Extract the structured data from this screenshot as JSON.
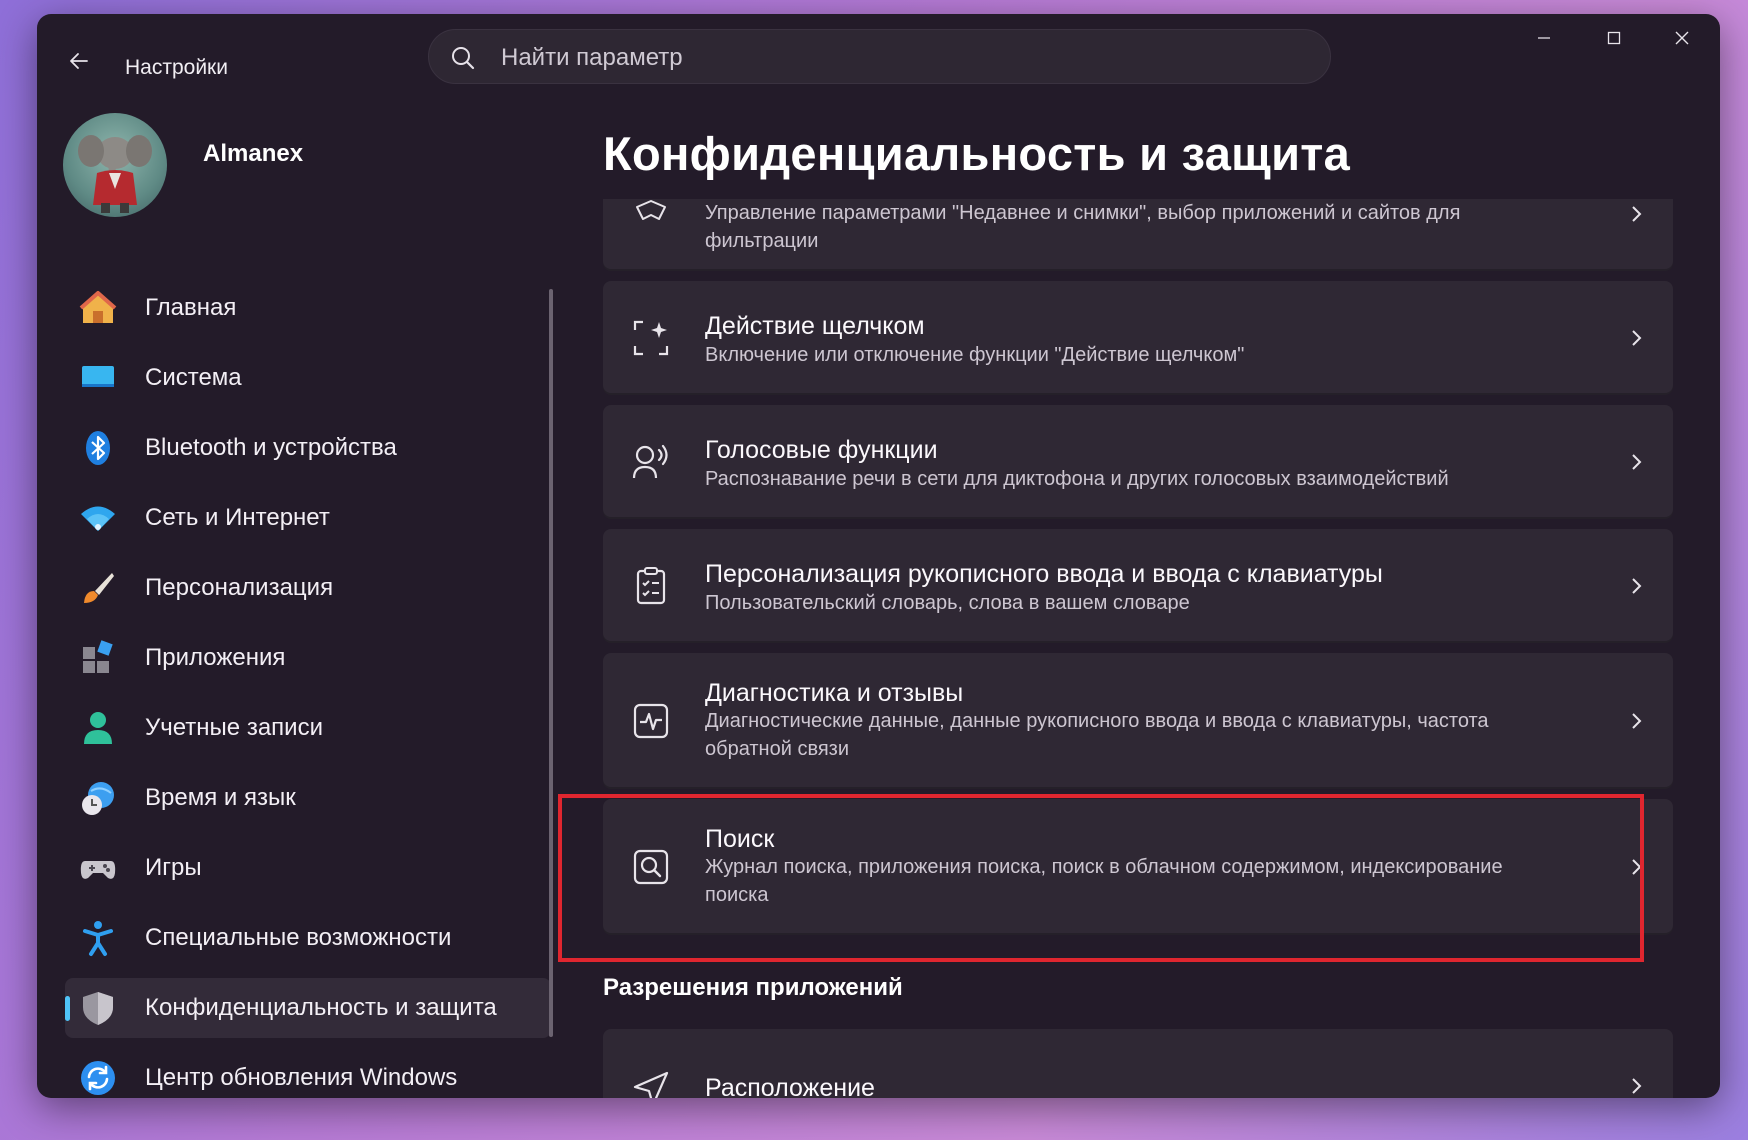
{
  "app": {
    "title": "Настройки"
  },
  "search": {
    "placeholder": "Найти параметр"
  },
  "user": {
    "name": "Almanex"
  },
  "sidebar": {
    "items": [
      {
        "label": "Главная",
        "icon": "home-icon"
      },
      {
        "label": "Система",
        "icon": "system-icon"
      },
      {
        "label": "Bluetooth и устройства",
        "icon": "bluetooth-icon"
      },
      {
        "label": "Сеть и Интернет",
        "icon": "wifi-icon"
      },
      {
        "label": "Персонализация",
        "icon": "brush-icon"
      },
      {
        "label": "Приложения",
        "icon": "apps-icon"
      },
      {
        "label": "Учетные записи",
        "icon": "account-icon"
      },
      {
        "label": "Время и язык",
        "icon": "time-language-icon"
      },
      {
        "label": "Игры",
        "icon": "gamepad-icon"
      },
      {
        "label": "Специальные возможности",
        "icon": "accessibility-icon"
      },
      {
        "label": "Конфиденциальность и защита",
        "icon": "shield-icon",
        "active": true
      },
      {
        "label": "Центр обновления Windows",
        "icon": "update-icon"
      }
    ]
  },
  "main": {
    "title": "Конфиденциальность и защита",
    "cards": [
      {
        "title": "",
        "description": "Управление параметрами \"Недавнее и снимки\", выбор приложений и сайтов для фильтрации",
        "icon": "recall-icon"
      },
      {
        "title": "Действие щелчком",
        "description": "Включение или отключение функции \"Действие щелчком\"",
        "icon": "click-to-do-icon"
      },
      {
        "title": "Голосовые функции",
        "description": "Распознавание речи в сети для диктофона и других голосовых взаимодействий",
        "icon": "speech-icon"
      },
      {
        "title": "Персонализация рукописного ввода и ввода с клавиатуры",
        "description": "Пользовательский словарь, слова в вашем словаре",
        "icon": "clipboard-icon"
      },
      {
        "title": "Диагностика и отзывы",
        "description": "Диагностические данные, данные рукописного ввода и ввода с клавиатуры, частота обратной связи",
        "icon": "diagnostics-icon"
      },
      {
        "title": "Поиск",
        "description": "Журнал поиска, приложения поиска, поиск в облачном содержимом, индексирование поиска",
        "icon": "search-permissions-icon",
        "highlighted": true
      }
    ],
    "section_heading": "Разрешения приложений",
    "section_cards": [
      {
        "title": "Расположение",
        "icon": "location-icon"
      }
    ]
  },
  "colors": {
    "accent": "#4fc3f7",
    "highlight": "#e0262f",
    "background": "#231b29",
    "card": "#2f2834"
  }
}
